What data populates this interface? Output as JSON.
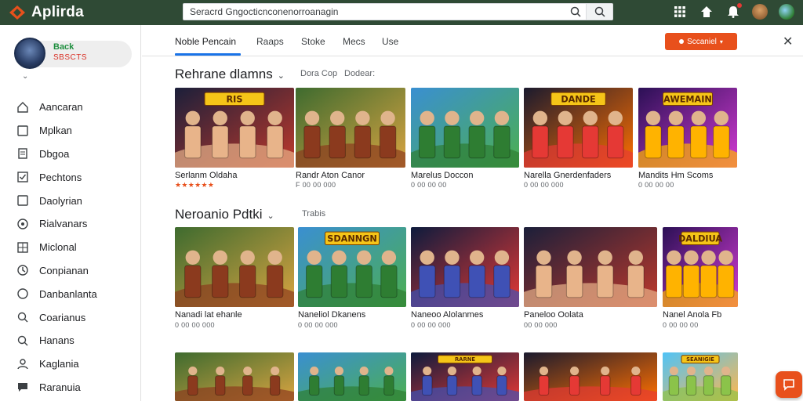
{
  "app": {
    "name": "Aplirda",
    "brand_color": "#e8501c",
    "topbar_color": "#2f4a35"
  },
  "search": {
    "value": "Seracrd Gngocticnconenorroanagin"
  },
  "topbar_icons": [
    "apps-grid-icon",
    "home-icon",
    "notifications-icon",
    "avatar",
    "avatar-globe"
  ],
  "profile": {
    "name": "Back",
    "subtitle": "SBSCTS"
  },
  "sidebar": {
    "items": [
      {
        "label": "Aancaran",
        "icon": "home-outline-icon"
      },
      {
        "label": "Mplkan",
        "icon": "square-icon"
      },
      {
        "label": "Dbgoa",
        "icon": "document-icon"
      },
      {
        "label": "Pechtons",
        "icon": "checkbox-icon"
      },
      {
        "label": "Daolyrian",
        "icon": "square-icon"
      },
      {
        "label": "Rialvanars",
        "icon": "target-icon"
      },
      {
        "label": "Miclonal",
        "icon": "grid-box-icon"
      },
      {
        "label": "Conpianan",
        "icon": "clock-icon"
      },
      {
        "label": "Danbanlanta",
        "icon": "circle-icon"
      },
      {
        "label": "Coarianus",
        "icon": "search-icon"
      },
      {
        "label": "Hanans",
        "icon": "search-icon"
      },
      {
        "label": "Kaglania",
        "icon": "person-icon"
      },
      {
        "label": "Raranuia",
        "icon": "chat-icon"
      }
    ]
  },
  "tabs": [
    {
      "label": "Noble Pencain",
      "active": true
    },
    {
      "label": "Raaps"
    },
    {
      "label": "Stoke"
    },
    {
      "label": "Mecs"
    },
    {
      "label": "Use"
    }
  ],
  "action_button": {
    "label": "Sccaniel"
  },
  "sections": [
    {
      "title": "Rehrane dlamns",
      "subs": [
        "Dora Cop",
        "Dodear:"
      ],
      "cards": [
        {
          "title": "Serlanm Oldaha",
          "meta": "★★★★★★",
          "theme": "portrait"
        },
        {
          "title": "Randr Aton Canor",
          "meta": "F 00 00 000",
          "theme": "soldiers"
        },
        {
          "title": "Marelus Doccon",
          "meta": "0 00 00 00",
          "theme": "field"
        },
        {
          "title": "Narella Gnerdenfaders",
          "meta": "0 00 00 000",
          "theme": "fire"
        },
        {
          "title": "Mandits Hm Scoms",
          "meta": "0 00 00 00",
          "theme": "neon"
        }
      ]
    },
    {
      "title": "Neroanio Pdtki",
      "subs": [
        "Trabis"
      ],
      "cards": [
        {
          "title": "Nanadi lat ehanle",
          "meta": "0 00 00 000",
          "theme": "soldiers"
        },
        {
          "title": "Naneliol Dkanens",
          "meta": "0 00 00 000",
          "theme": "field"
        },
        {
          "title": "Naneoo Alolanmes",
          "meta": "0 00 00 000",
          "theme": "space"
        },
        {
          "title": "Paneloo Oolata",
          "meta": "00 00 000",
          "theme": "portrait"
        },
        {
          "title": "Nanel Anola Fb",
          "meta": "0 00 00 00",
          "theme": "neon"
        }
      ]
    },
    {
      "title": "",
      "subs": [],
      "cards": [
        {
          "title": "",
          "meta": "",
          "theme": "soldiers"
        },
        {
          "title": "",
          "meta": "",
          "theme": "field"
        },
        {
          "title": "",
          "meta": "",
          "theme": "space"
        },
        {
          "title": "",
          "meta": "",
          "theme": "fire"
        },
        {
          "title": "",
          "meta": "",
          "theme": "sky"
        }
      ]
    }
  ],
  "badges": {
    "thumb_banners": [
      "RIS",
      "DANDE",
      "AWEMAIN",
      "SDANNGN",
      "DALDIUA",
      "RARNE",
      "SEANIGIE"
    ]
  }
}
